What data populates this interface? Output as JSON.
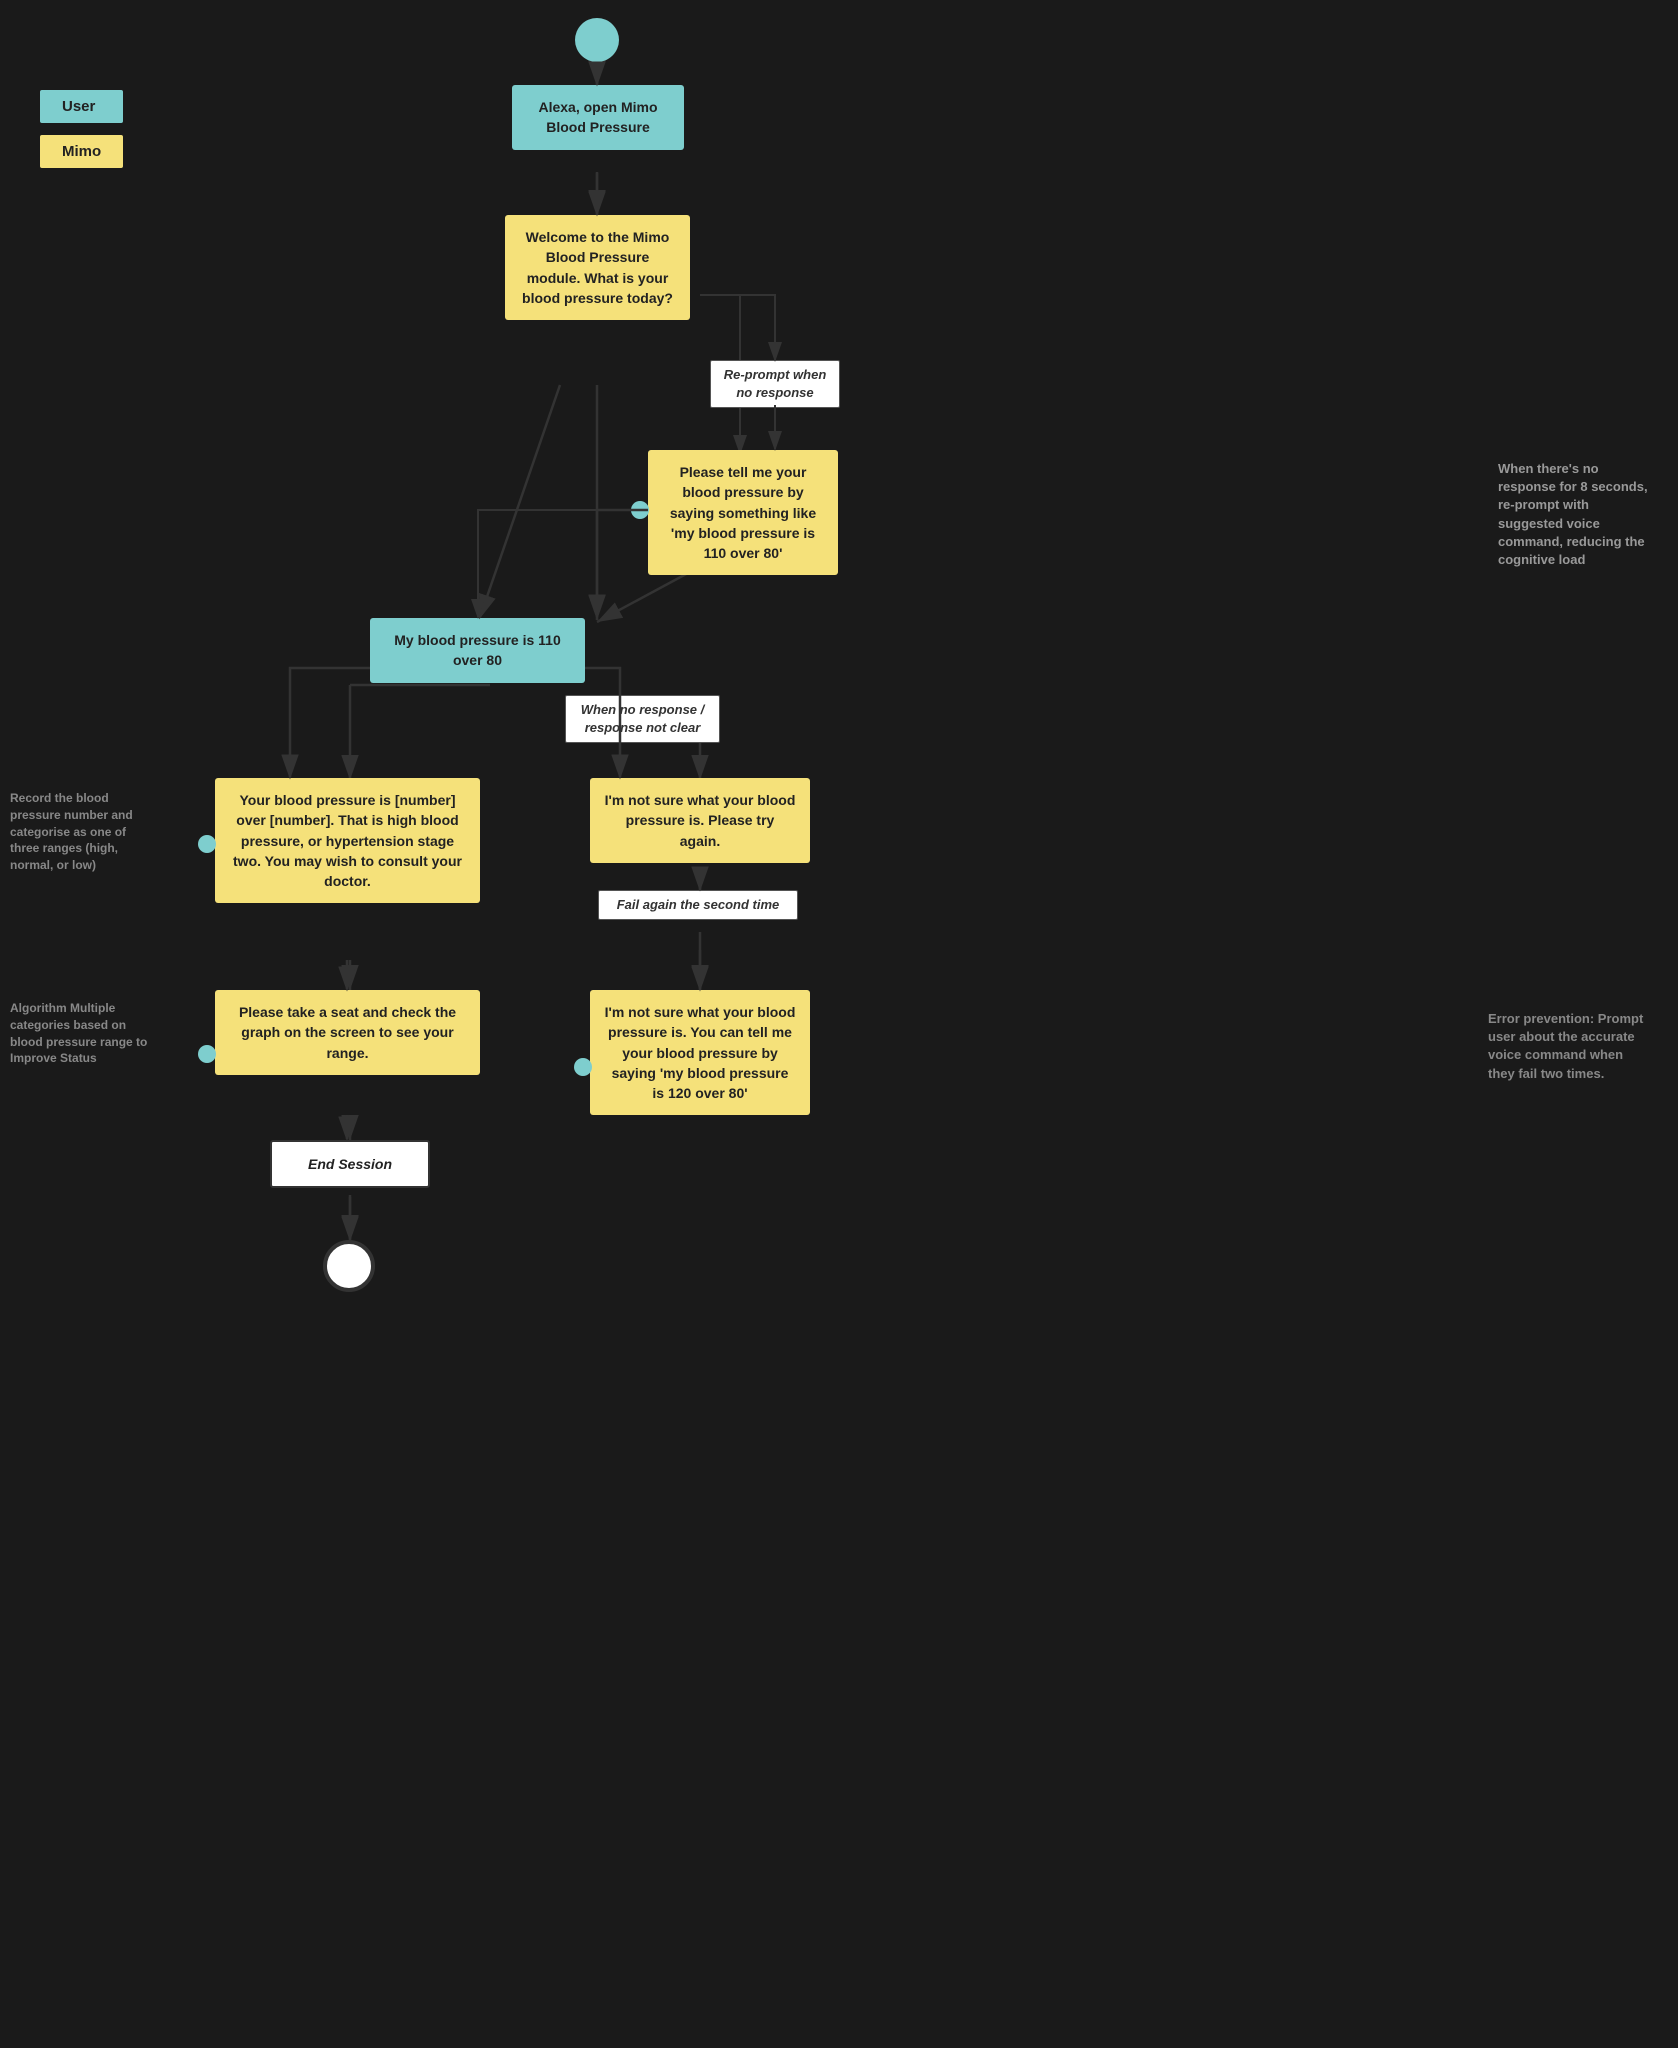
{
  "legend": {
    "user_label": "User",
    "mimo_label": "Mimo"
  },
  "boxes": {
    "start_label": "Alexa, open Mimo Blood Pressure",
    "welcome_label": "Welcome to the Mimo Blood Pressure module. What is your blood pressure today?",
    "reprompt_label": "Please tell me your blood pressure by saying something like 'my blood pressure is 110 over 80'",
    "user_input_label": "My blood pressure is 110 over 80",
    "high_bp_response": "Your blood pressure is [number] over [number]. That is high blood pressure, or hypertension stage two. You may wish to consult your doctor.",
    "seat_label": "Please take a seat and check the graph on the screen to see your range.",
    "not_sure_first": "I'm not sure what your blood pressure is. Please try again.",
    "not_sure_second": "I'm not sure what your blood pressure is.  You can tell me your blood pressure by saying 'my blood pressure is 120 over 80'",
    "end_session": "End Session"
  },
  "labels": {
    "reprompt_when": "Re-prompt when no response",
    "fail_again": "Fail again the second time",
    "when_no_response": "When no response / response not clear",
    "when_no_response_note": "When there's no response for 8 seconds, re-prompt with suggested voice command, reducing the cognitive load",
    "record_bp_note": "Record the blood pressure number and categorise as one of three ranges (high, normal, or low)",
    "algo_note": "Algorithm Multiple categories based on blood pressure range to Improve Status",
    "error_prevention": "Error prevention: Prompt user about the accurate voice command when they fail two times."
  },
  "colors": {
    "user": "#7ecece",
    "mimo": "#f5e17a",
    "arrow": "#333333",
    "annotation": "#999999"
  }
}
